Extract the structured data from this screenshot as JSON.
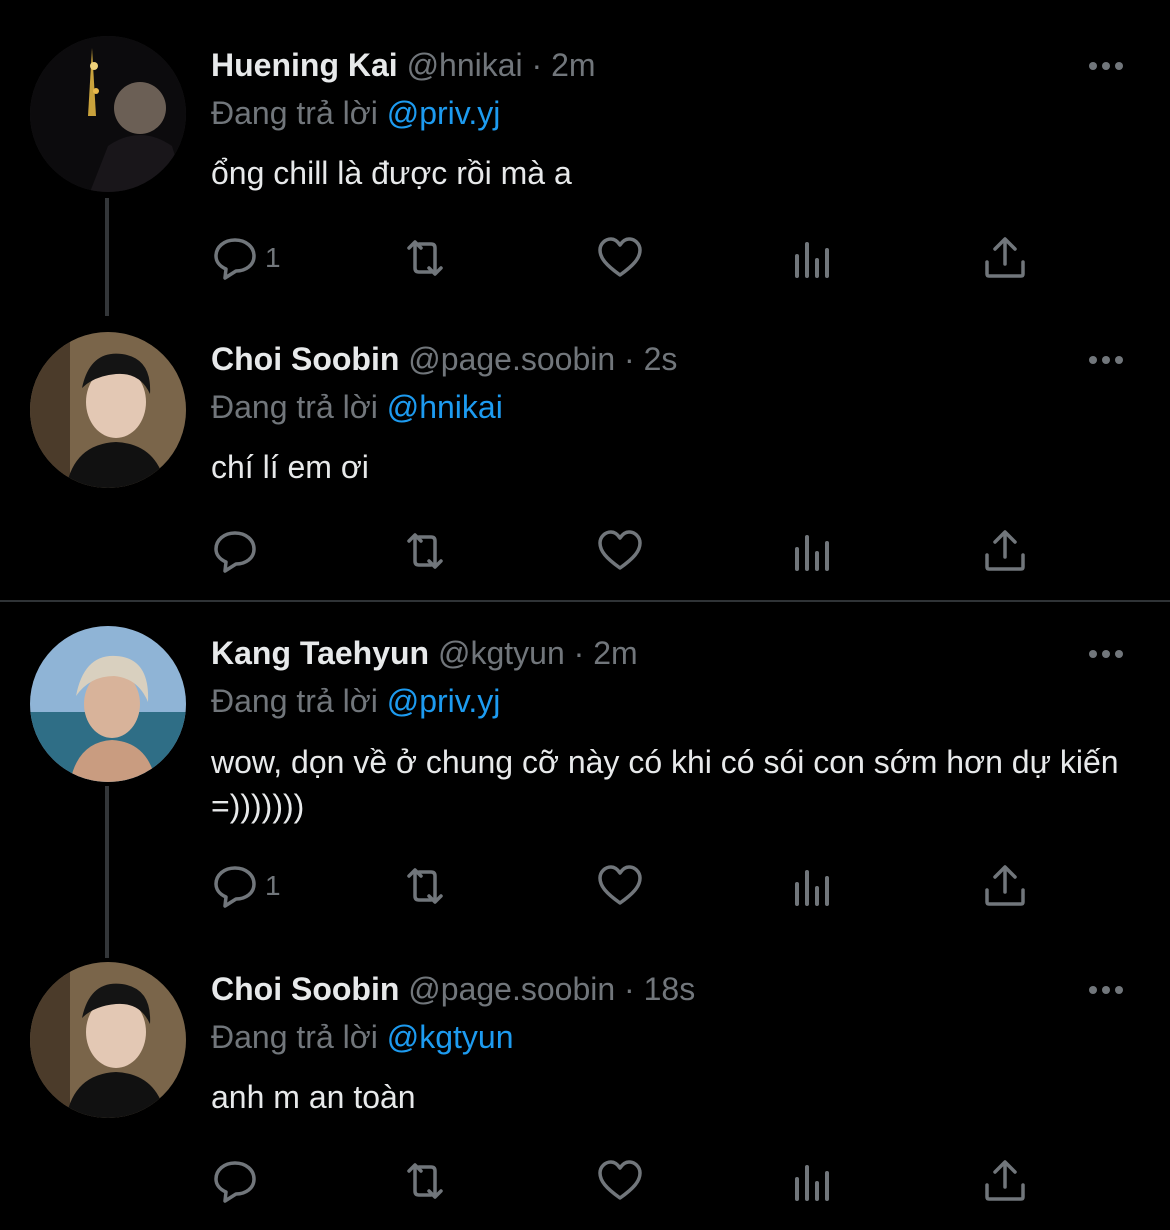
{
  "reply_prefix": "Đang trả lời",
  "colors": {
    "background": "#000000",
    "text": "#e7e9ea",
    "muted": "#71767b",
    "accent": "#1d9bf0",
    "thread_line": "#333639"
  },
  "icons": [
    "reply-icon",
    "retweet-icon",
    "like-icon",
    "views-icon",
    "share-icon",
    "more-icon"
  ],
  "tweets": [
    {
      "name": "Huening Kai",
      "handle": "@hnikai",
      "separator": "·",
      "time": "2m",
      "reply_to": "@priv.yj",
      "text": "ổng chill là được rồi mà a",
      "reply_count": "1"
    },
    {
      "name": "Choi Soobin",
      "handle": "@page.soobin",
      "separator": "·",
      "time": "2s",
      "reply_to": "@hnikai",
      "text": "chí lí em ơi",
      "reply_count": ""
    },
    {
      "name": "Kang Taehyun",
      "handle": "@kgtyun",
      "separator": "·",
      "time": "2m",
      "reply_to": "@priv.yj",
      "text": "wow, dọn về ở chung cỡ này có khi có sói con sớm hơn dự kiến =)))))))",
      "reply_count": "1"
    },
    {
      "name": "Choi Soobin",
      "handle": "@page.soobin",
      "separator": "·",
      "time": "18s",
      "reply_to": "@kgtyun",
      "text": "anh m an toàn",
      "reply_count": ""
    }
  ]
}
